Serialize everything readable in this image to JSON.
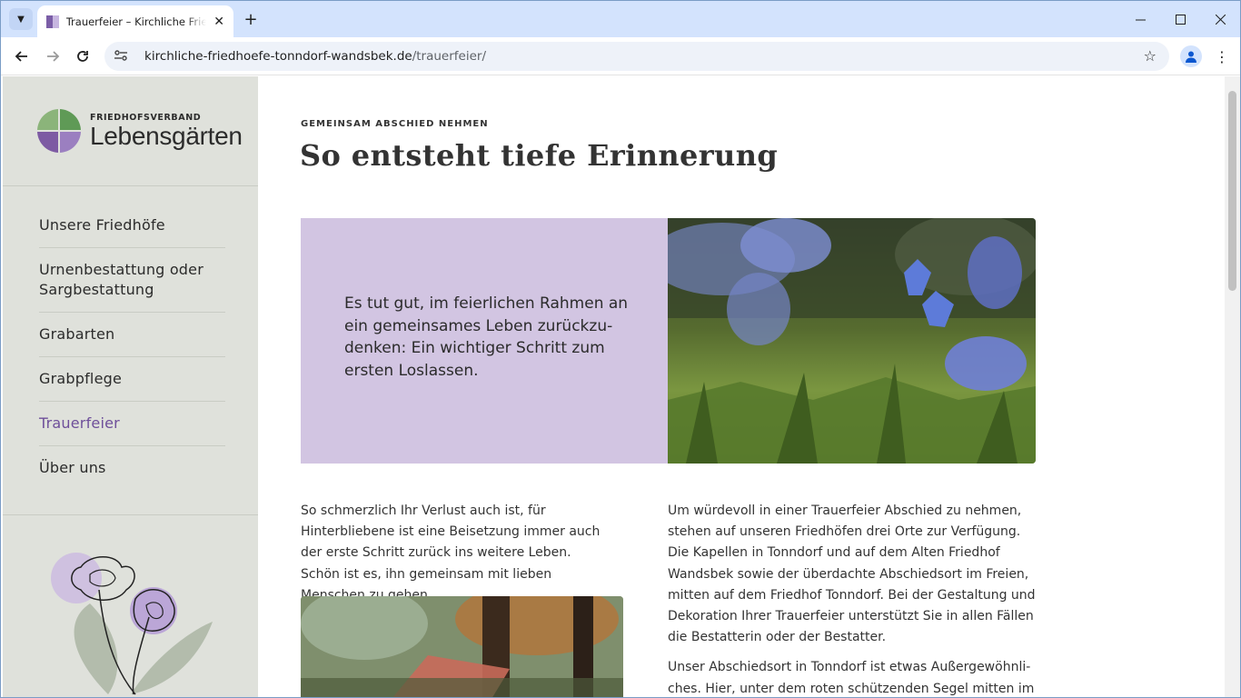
{
  "browser": {
    "tab_title": "Trauerfeier – Kirchliche Friedhöfe",
    "tab_close": "✕",
    "new_tab": "+",
    "url_domain": "kirchliche-friedhoefe-tonndorf-wandsbek.de",
    "url_path": "/trauerfeier/"
  },
  "logo": {
    "small": "FRIEDHOFSVERBAND",
    "big": "Lebensgärten"
  },
  "nav": {
    "items": [
      {
        "label": "Unsere Friedhöfe"
      },
      {
        "label": "Urnenbestattung oder Sargbestattung"
      },
      {
        "label": "Grabarten"
      },
      {
        "label": "Grabpflege"
      },
      {
        "label": "Trauerfeier",
        "active": true
      },
      {
        "label": "Über uns"
      }
    ]
  },
  "main": {
    "kicker": "GEMEINSAM ABSCHIED NEHMEN",
    "headline": "So entsteht tiefe Erinnerung",
    "hero_quote": "Es tut gut, im feierlichen Rahmen an ein gemeinsames Leben zurückzu­denken: Ein wichtiger Schritt zum ersten Loslassen.",
    "left_paragraph": "So schmerzlich Ihr Verlust auch ist, für Hinterblie­bene ist eine Beisetzung immer auch der erste Schritt zurück ins weitere Leben. Schön ist es, ihn gemeinsam mit lieben Menschen zu gehen.",
    "right_paragraph_1": "Um würdevoll in einer Trauerfeier Abschied zu nehmen, ste­hen auf unseren Friedhöfen drei Orte zur Verfügung. Die Ka­pellen in Tonndorf und auf dem Alten Friedhof Wandsbek sowie der überdachte Abschiedsort im Freien, mitten auf dem Friedhof Tonndorf. Bei der Gestaltung und Dekoration Ihrer Trauerfeier unterstützt Sie in allen Fällen die Bestatte­rin oder der Bestatter.",
    "right_paragraph_2": "Unser Abschiedsort in Tonndorf ist etwas Außergewöhnli­ches. Hier, unter dem roten schützenden Segel mitten im"
  },
  "colors": {
    "accent": "#6e4f9a",
    "hero_box": "#d2c5e2",
    "sidebar_bg": "#dfe1db"
  },
  "icons": {
    "tab_menu": "chevron-down-icon",
    "back": "arrow-left-icon",
    "forward": "arrow-right-icon",
    "reload": "reload-icon",
    "site_info": "tune-icon",
    "bookmark": "star-icon",
    "profile": "person-icon",
    "menu": "kebab-icon"
  }
}
